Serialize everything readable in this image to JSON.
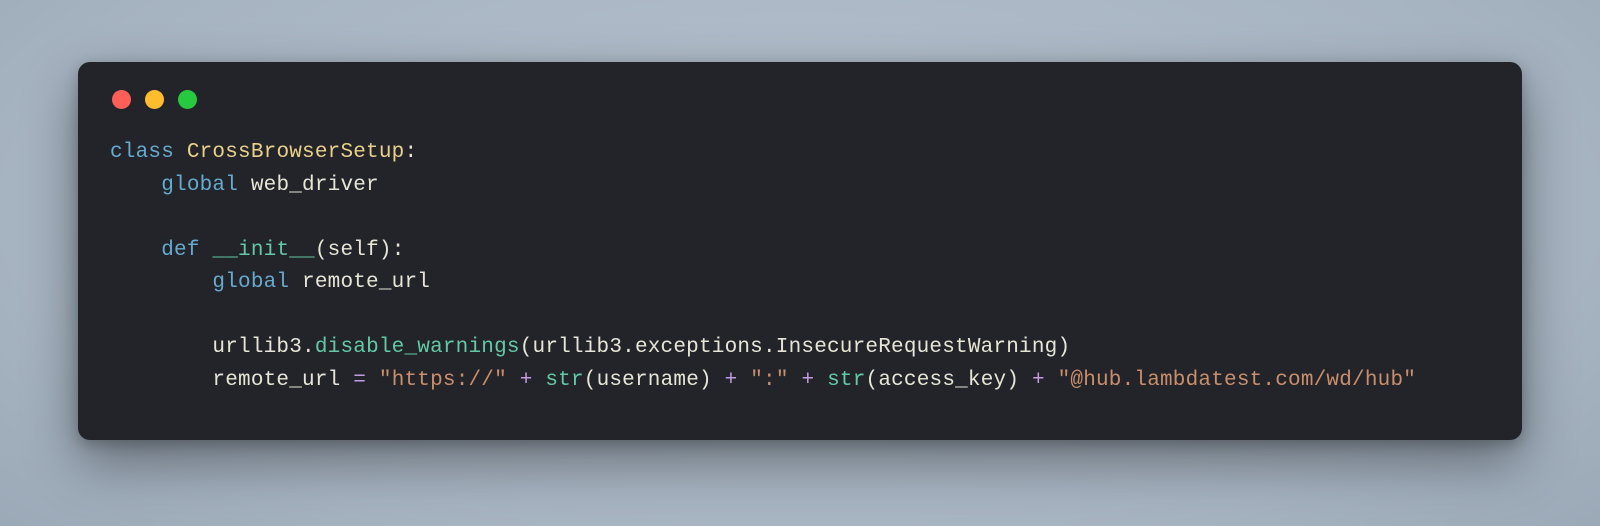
{
  "colors": {
    "window_bg": "#22242a",
    "traffic_red": "#ff5f56",
    "traffic_yellow": "#ffbd2e",
    "traffic_green": "#27c93f",
    "keyword": "#66aace",
    "classname": "#e9d18a",
    "identifier": "#e7e5d5",
    "function": "#63c9a4",
    "string": "#c98e6b",
    "operator": "#c29be0"
  },
  "code": {
    "kw_class": "class",
    "class_name": "CrossBrowserSetup",
    "colon": ":",
    "kw_global": "global",
    "var_web_driver": "web_driver",
    "kw_def": "def",
    "fn_init": "__init__",
    "paren_open": "(",
    "paren_close": ")",
    "param_self": "self",
    "var_remote_url": "remote_url",
    "mod_urllib3": "urllib3",
    "dot": ".",
    "fn_disable_warnings": "disable_warnings",
    "attr_exceptions": "exceptions",
    "cls_insecure": "InsecureRequestWarning",
    "op_eq": "=",
    "op_plus": "+",
    "str_https": "\"https://\"",
    "fn_str": "str",
    "var_username": "username",
    "str_colon": "\":\"",
    "var_access_key": "access_key",
    "str_hub": "\"@hub.lambdatest.com/wd/hub\""
  }
}
